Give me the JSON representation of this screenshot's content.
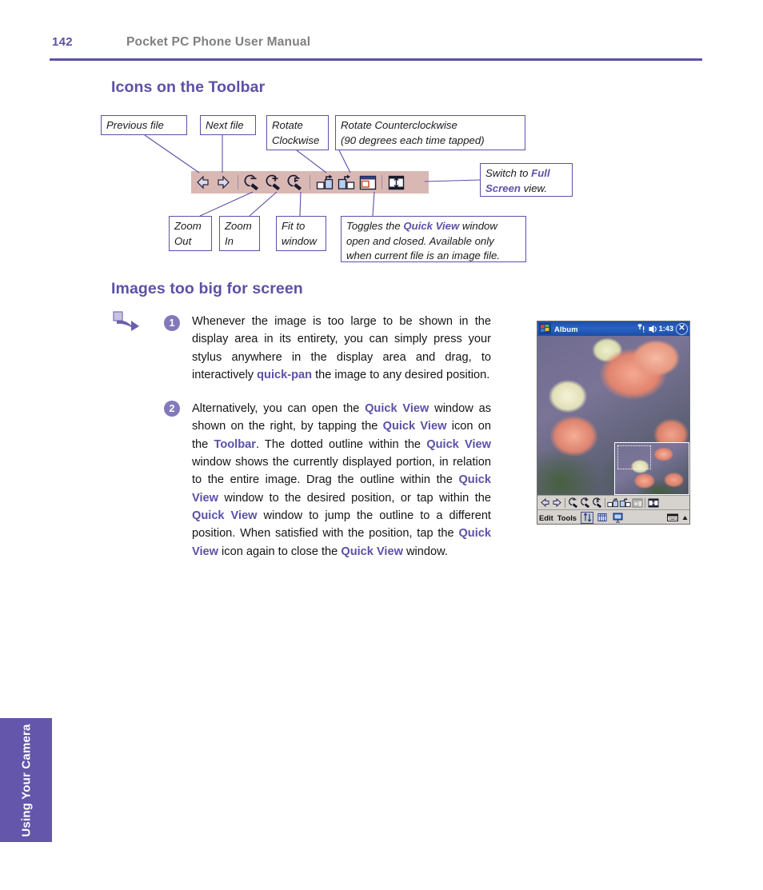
{
  "header": {
    "page_number": "142",
    "title": "Pocket PC Phone User Manual",
    "rule_color": "#5c51a8"
  },
  "headings": {
    "icons_on_toolbar": "Icons on the Toolbar",
    "images_too_big": "Images too big for screen"
  },
  "toolbar_diagram": {
    "strip_color": "#d9b8b4",
    "callouts": {
      "previous_file": "Previous file",
      "next_file": "Next file",
      "rotate_clockwise": "Rotate Clockwise",
      "rotate_counterclockwise_line1": "Rotate Counterclockwise",
      "rotate_counterclockwise_line2": "(90 degrees each time tapped)",
      "switch_full_screen_pre": "Switch to ",
      "switch_full_screen_bold": "Full Screen",
      "switch_full_screen_post": " view.",
      "zoom_out": "Zoom Out",
      "zoom_in": "Zoom In",
      "fit_to_window": "Fit to window",
      "toggle_pre": "Toggles the ",
      "toggle_bold": "Quick View",
      "toggle_post": " window open and closed. Available only when current file is an image file."
    },
    "icons": [
      "previous-file-icon",
      "next-file-icon",
      "zoom-out-icon",
      "zoom-in-icon",
      "fit-to-window-icon",
      "rotate-clockwise-icon",
      "rotate-counterclockwise-icon",
      "quick-view-icon",
      "full-screen-icon"
    ]
  },
  "body": {
    "bullet_1": "1",
    "bullet_2": "2",
    "par1": {
      "t1": "Whenever the image is too large to be shown in the display area in its entirety, you can simply press your stylus anywhere in the display area and drag, to interactively ",
      "b1": "quick-pan",
      "t2": " the image to any desired position."
    },
    "par2": {
      "t1": "Alternatively, you can open the ",
      "b1": "Quick View",
      "t2": " window as shown on the right, by tapping the ",
      "b2": "Quick View",
      "t3": " icon on the ",
      "b3": "Toolbar",
      "t4": ".  The dotted outline within the ",
      "b4": "Quick View",
      "t5": " window shows the currently displayed portion, in relation to the entire image. Drag the outline within the ",
      "b5": "Quick View",
      "t6": " window to the desired position, or tap within the ",
      "b6": "Quick View",
      "t7": " window to jump the outline to a different position.  When satisfied with the position, tap the ",
      "b7": "Quick View",
      "t8": " icon again to close the ",
      "b8": "Quick View",
      "t9": " window."
    }
  },
  "pda_screenshot": {
    "app_title": "Album",
    "clock": "1:43",
    "status_icons": [
      "signal-icon",
      "speaker-icon"
    ],
    "close_label": "✕",
    "start_icon": "windows-start-icon",
    "toolbar_icons": [
      "previous-file-icon",
      "next-file-icon",
      "zoom-out-icon",
      "zoom-in-icon",
      "fit-to-window-icon",
      "rotate-clockwise-icon",
      "rotate-counterclockwise-icon",
      "quick-view-icon",
      "full-screen-icon"
    ],
    "menu": {
      "edit": "Edit",
      "tools": "Tools",
      "buttons": [
        "sort-icon",
        "thumbnails-icon",
        "slideshow-icon"
      ],
      "sip_icon": "keyboard-icon",
      "sip_arrow": "chevron-up-icon"
    },
    "quick_view": {
      "label": "quick-view-inset",
      "outline": "dotted-viewport-outline"
    }
  },
  "side_tab": {
    "label": "Using Your Camera",
    "color": "#6356ab"
  }
}
